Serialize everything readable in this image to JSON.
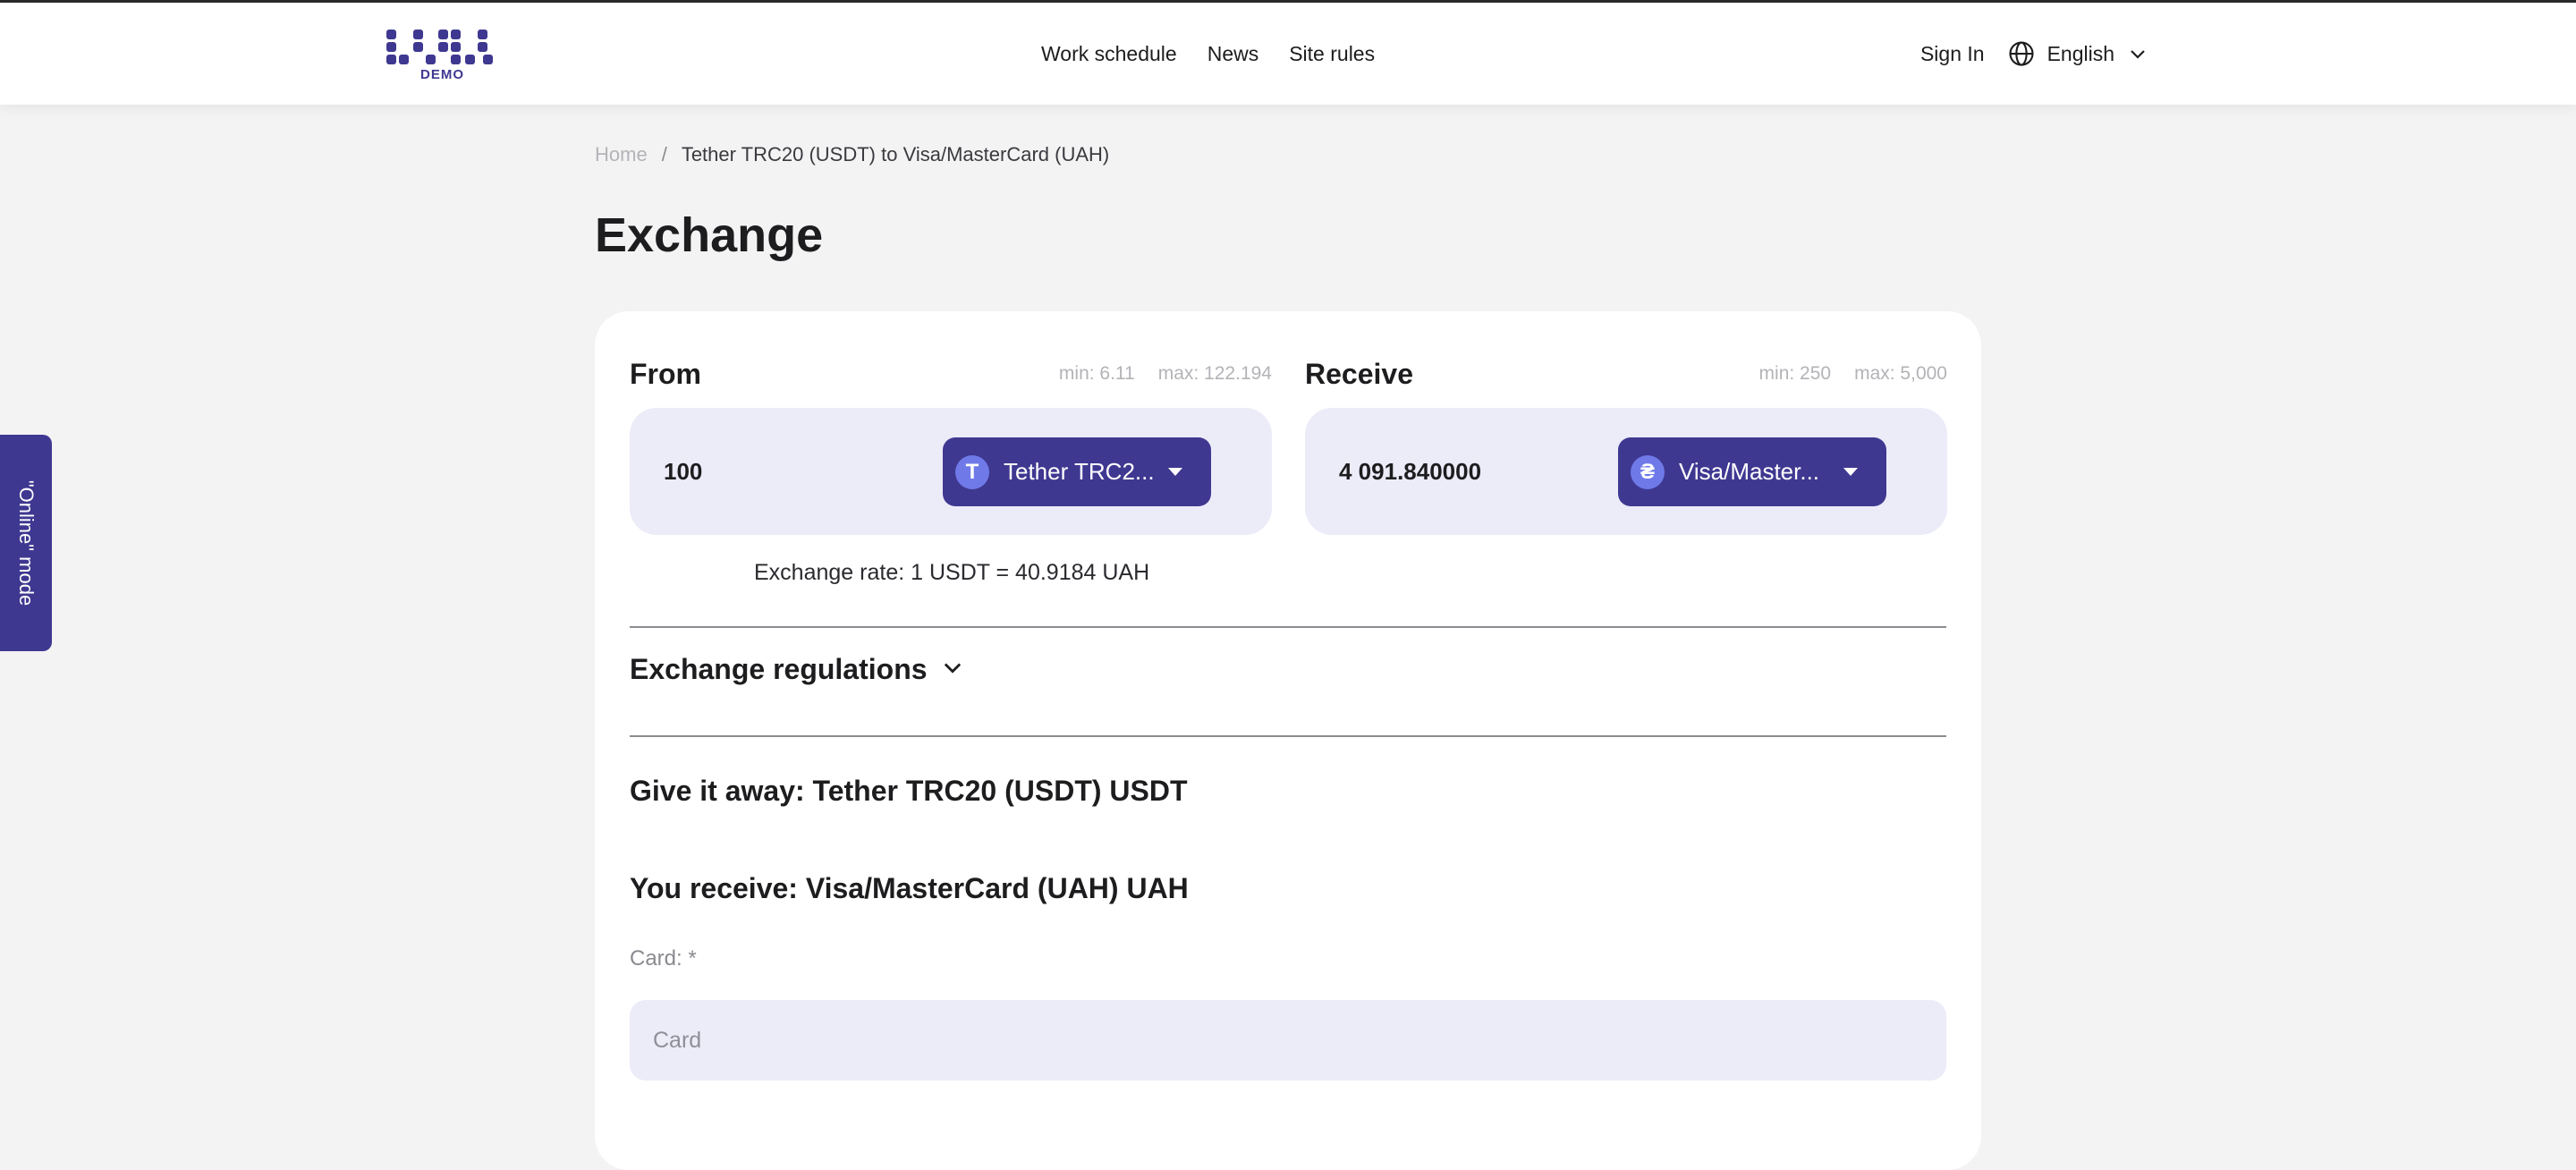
{
  "header": {
    "logo_text": "DEMO",
    "nav": [
      "Work schedule",
      "News",
      "Site rules"
    ],
    "sign_in": "Sign In",
    "language": "English"
  },
  "breadcrumb": {
    "home": "Home",
    "separator": "/",
    "current": "Tether TRC20 (USDT) to Visa/MasterCard (UAH)"
  },
  "page_title": "Exchange",
  "from": {
    "label": "From",
    "min": "min: 6.11",
    "max": "max: 122.194",
    "amount": "100",
    "currency": "Tether TRC2...",
    "icon_glyph": "T"
  },
  "receive": {
    "label": "Receive",
    "min": "min: 250",
    "max": "max: 5,000",
    "amount": "4 091.840000",
    "currency": "Visa/Master...",
    "icon_glyph": "₴"
  },
  "rate_text": "Exchange rate: 1 USDT = 40.9184 UAH",
  "regulations": "Exchange regulations",
  "give_text": "Give it away: Tether TRC20 (USDT) USDT",
  "receive_text": "You receive: Visa/MasterCard (UAH) UAH",
  "card_label": "Card: *",
  "card_placeholder": "Card",
  "online_mode": "\"Online\" mode",
  "colors": {
    "accent": "#3f3891",
    "coin": "#6f7ae8",
    "field_bg": "#ecebf8",
    "page_bg": "#f4f3f4"
  }
}
